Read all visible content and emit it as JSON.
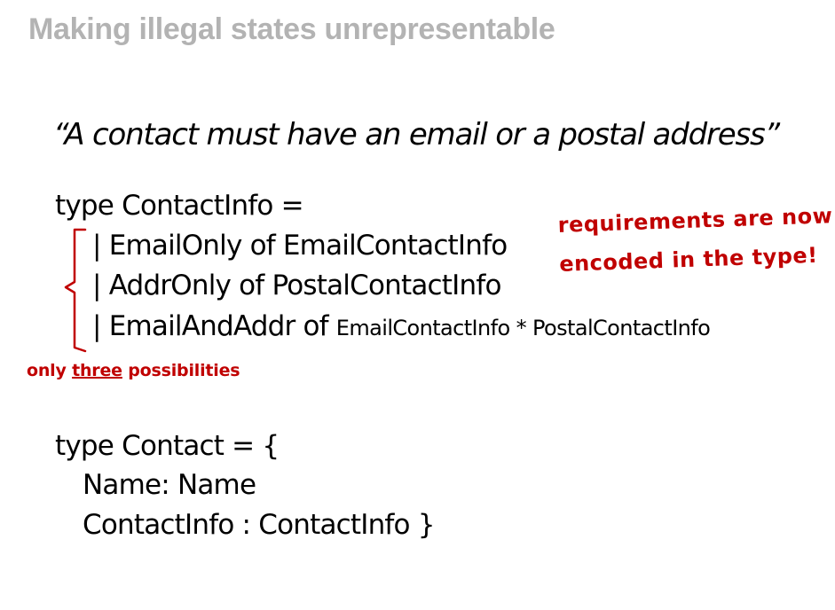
{
  "slide": {
    "title": "Making illegal states unrepresentable",
    "quote": "“A contact must have an email or a postal address”"
  },
  "contact_info_type": {
    "header": "type ContactInfo =",
    "cases": [
      {
        "prefix": "| EmailOnly of EmailContactInfo",
        "suffix": ""
      },
      {
        "prefix": "| AddrOnly of PostalContactInfo",
        "suffix": ""
      },
      {
        "prefix": "| EmailAndAddr of ",
        "suffix": "EmailContactInfo * PostalContactInfo"
      }
    ]
  },
  "contact_type": {
    "header": "type Contact = {",
    "fields": [
      "Name: Name",
      "ContactInfo : ContactInfo  }"
    ]
  },
  "annotations": {
    "requirements_line1": "requirements are now",
    "requirements_line2": "encoded in the type!",
    "possibilities_before": "only ",
    "possibilities_underlined": "three",
    "possibilities_after": " possibilities",
    "color": "#c00000"
  }
}
